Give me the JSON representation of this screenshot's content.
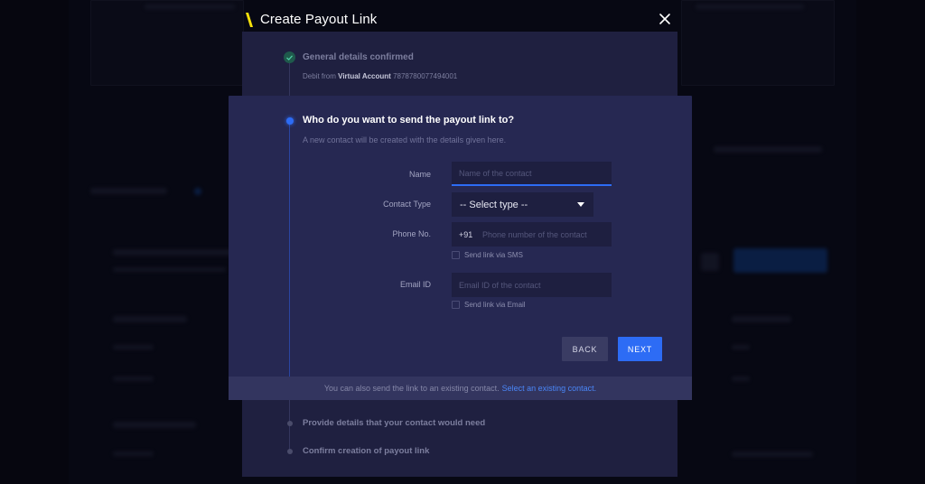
{
  "modal": {
    "title": "Create Payout Link",
    "close_icon": "close-icon",
    "logo_icon": "slash-logo-icon",
    "accent_color": "#f5e00a"
  },
  "steps": {
    "completed": {
      "title": "General details confirmed",
      "debit_prefix": "Debit from",
      "account_type": "Virtual Account",
      "account_number": "7878780077494001",
      "status_icon": "check-icon"
    },
    "active": {
      "title": "Who do you want to send the payout link to?",
      "subtitle": "A new contact will be created with the details given here."
    },
    "pending": [
      {
        "title": "Provide details that your contact would need"
      },
      {
        "title": "Confirm creation of payout link"
      }
    ]
  },
  "form": {
    "name": {
      "label": "Name",
      "value": "",
      "placeholder": "Name of the contact"
    },
    "contact_type": {
      "label": "Contact Type",
      "selected": "-- Select type --"
    },
    "phone": {
      "label": "Phone No.",
      "prefix": "+91",
      "value": "",
      "placeholder": "Phone number of the contact",
      "checkbox_label": "Send link via SMS",
      "checked": false
    },
    "email": {
      "label": "Email ID",
      "value": "",
      "placeholder": "Email ID of the contact",
      "checkbox_label": "Send link via Email",
      "checked": false
    }
  },
  "buttons": {
    "back": "BACK",
    "next": "NEXT"
  },
  "footer": {
    "text": "You can also send the link to an existing contact.",
    "link": "Select an existing contact."
  },
  "colors": {
    "primary": "#2d6cf5",
    "panel": "#1f2040",
    "card": "#262852",
    "success": "#1f5a4c"
  }
}
